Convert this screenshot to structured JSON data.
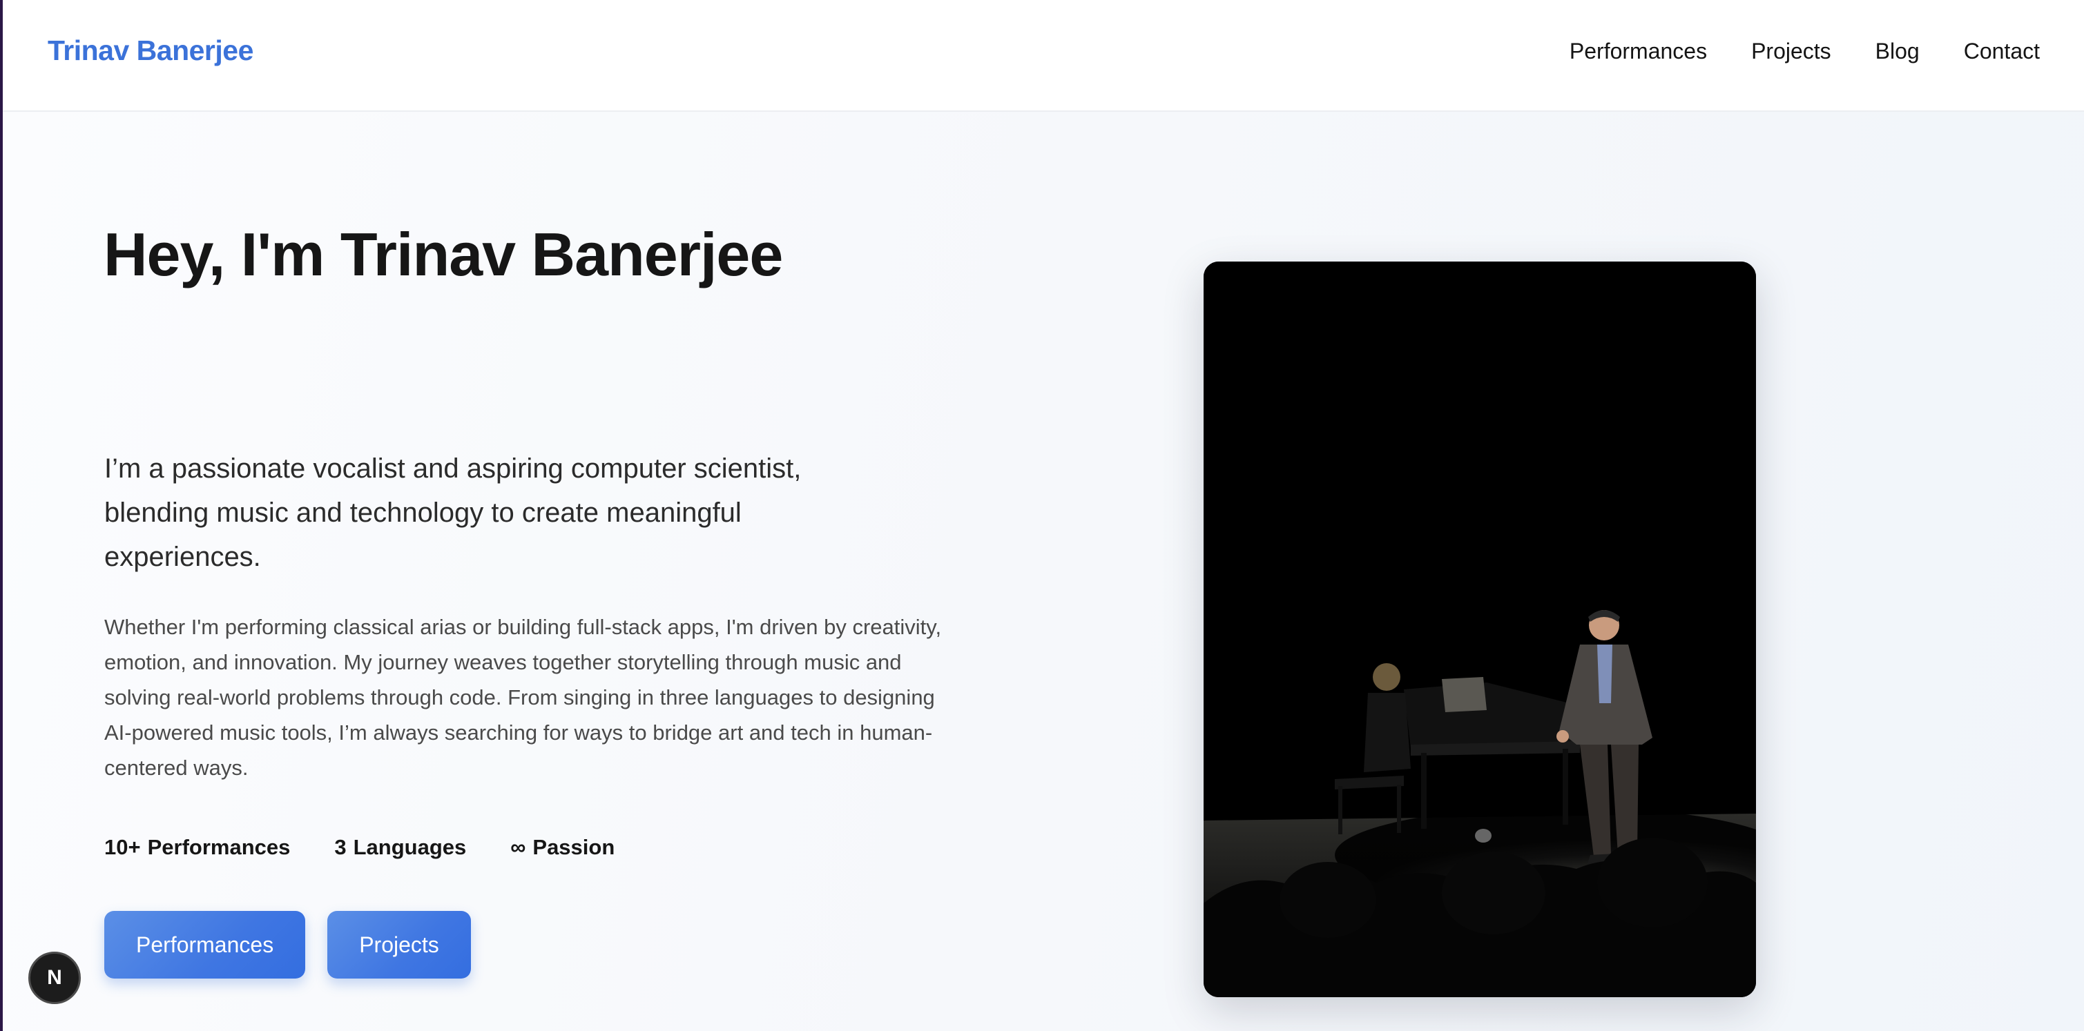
{
  "nav": {
    "brand": "Trinav Banerjee",
    "links": [
      "Performances",
      "Projects",
      "Blog",
      "Contact"
    ]
  },
  "hero": {
    "headline": "Hey, I'm Trinav Banerjee",
    "subtitle": "I’m a passionate vocalist and aspiring computer scientist, blending music and technology to create meaningful experiences.",
    "bio": "Whether I'm performing classical arias or building full-stack apps, I'm driven by creativity, emotion, and innovation. My journey weaves together storytelling through music and solving real-world problems through code. From singing in three languages to designing AI-powered music tools, I’m always searching for ways to bridge art and tech in human-centered ways.",
    "stats": [
      {
        "value": "10+",
        "label": "Performances"
      },
      {
        "value": "3",
        "label": "Languages"
      },
      {
        "value": "∞",
        "label": "Passion"
      }
    ],
    "buttons": {
      "performances": "Performances",
      "projects": "Projects"
    }
  },
  "dev_badge": {
    "letter": "N",
    "icon": "nextjs-logo-icon"
  },
  "colors": {
    "brand": "#3b72d9",
    "button": "#3f76e2",
    "page_background": "#f7f9fc"
  }
}
